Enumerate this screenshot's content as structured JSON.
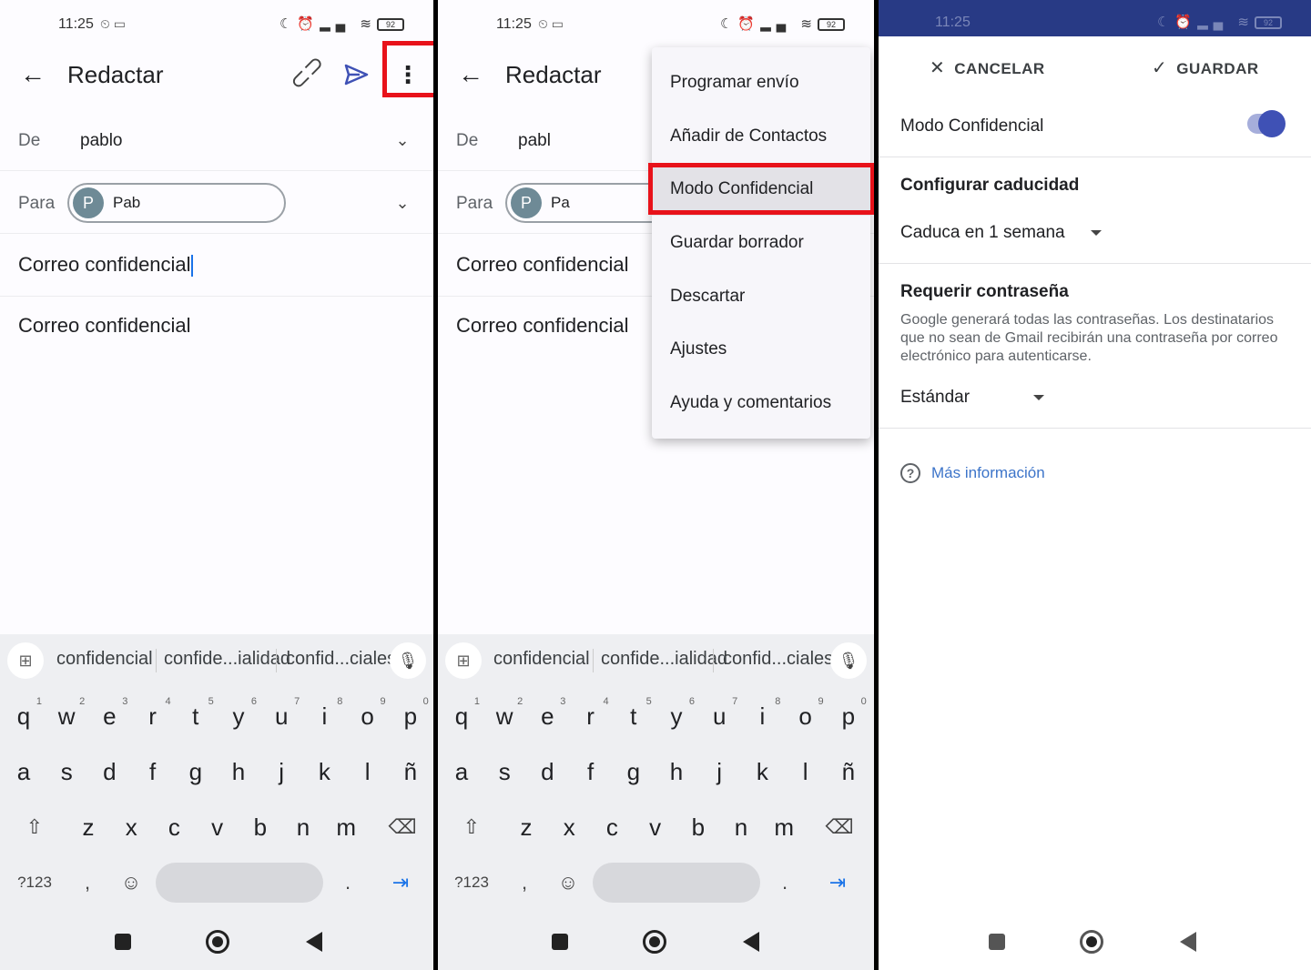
{
  "status": {
    "time": "11:25",
    "battery": "92"
  },
  "compose": {
    "title": "Redactar",
    "from_label": "De",
    "from_value_1": "pablo",
    "from_value_2": "pabl",
    "to_label": "Para",
    "recipient_initial": "P",
    "recipient_name_1": "Pab",
    "recipient_name_2": "Pa",
    "subject": "Correo confidencial",
    "body": "Correo confidencial"
  },
  "keyboard": {
    "suggestions": [
      "confidencial",
      "confide...ialidad",
      "confid...ciales"
    ],
    "row1": [
      {
        "k": "q",
        "n": "1"
      },
      {
        "k": "w",
        "n": "2"
      },
      {
        "k": "e",
        "n": "3"
      },
      {
        "k": "r",
        "n": "4"
      },
      {
        "k": "t",
        "n": "5"
      },
      {
        "k": "y",
        "n": "6"
      },
      {
        "k": "u",
        "n": "7"
      },
      {
        "k": "i",
        "n": "8"
      },
      {
        "k": "o",
        "n": "9"
      },
      {
        "k": "p",
        "n": "0"
      }
    ],
    "row2": [
      "a",
      "s",
      "d",
      "f",
      "g",
      "h",
      "j",
      "k",
      "l",
      "ñ"
    ],
    "row3": [
      "z",
      "x",
      "c",
      "v",
      "b",
      "n",
      "m"
    ],
    "symbols_label": "?123",
    "comma": ",",
    "period": "."
  },
  "menu": {
    "items": [
      "Programar envío",
      "Añadir de Contactos",
      "Modo Confidencial",
      "Guardar borrador",
      "Descartar",
      "Ajustes",
      "Ayuda y comentarios"
    ],
    "active_index": 2
  },
  "confidential": {
    "cancel": "CANCELAR",
    "save": "GUARDAR",
    "mode_label": "Modo Confidencial",
    "mode_enabled": true,
    "expiry_heading": "Configurar caducidad",
    "expiry_value": "Caduca en 1 semana",
    "password_heading": "Requerir contraseña",
    "password_desc": "Google generará todas las contraseñas. Los destinatarios que no sean de Gmail recibirán una contraseña por correo electrónico para autenticarse.",
    "password_value": "Estándar",
    "help_link": "Más información"
  },
  "colors": {
    "highlight": "#e8121a",
    "accent": "#3f51b5",
    "status_bar": "#283a85",
    "link": "#3c74c9"
  }
}
